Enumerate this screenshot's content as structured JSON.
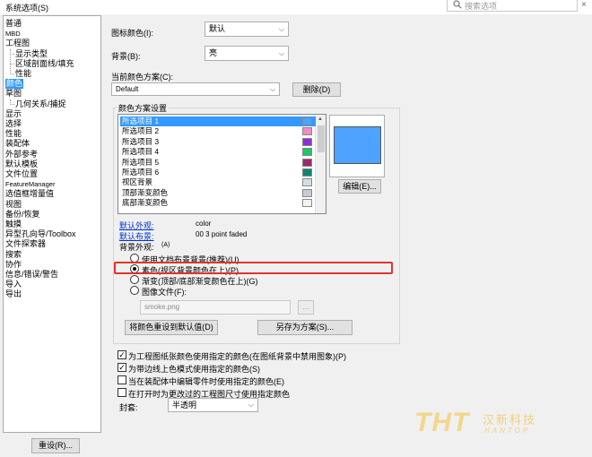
{
  "window": {
    "title": "系统选项(S)",
    "search_placeholder": "搜索选项",
    "close": "×"
  },
  "tree": {
    "items": [
      {
        "label": "普通",
        "level": 0,
        "selected": false
      },
      {
        "label": "MBD",
        "level": 0,
        "selected": false,
        "small": true
      },
      {
        "label": "工程图",
        "level": 0,
        "selected": false
      },
      {
        "label": "显示类型",
        "level": 1,
        "selected": false
      },
      {
        "label": "区域剖面线/填充",
        "level": 1,
        "selected": false
      },
      {
        "label": "性能",
        "level": 1,
        "selected": false
      },
      {
        "label": "颜色",
        "level": 0,
        "selected": true
      },
      {
        "label": "草图",
        "level": 0,
        "selected": false
      },
      {
        "label": "几何关系/捕捉",
        "level": 1,
        "selected": false
      },
      {
        "label": "显示",
        "level": 0,
        "selected": false
      },
      {
        "label": "选择",
        "level": 0,
        "selected": false
      },
      {
        "label": "性能",
        "level": 0,
        "selected": false
      },
      {
        "label": "装配体",
        "level": 0,
        "selected": false
      },
      {
        "label": "外部参考",
        "level": 0,
        "selected": false
      },
      {
        "label": "默认模板",
        "level": 0,
        "selected": false
      },
      {
        "label": "文件位置",
        "level": 0,
        "selected": false
      },
      {
        "label": "FeatureManager",
        "level": 0,
        "selected": false,
        "small": true
      },
      {
        "label": "选值框增量值",
        "level": 0,
        "selected": false
      },
      {
        "label": "视图",
        "level": 0,
        "selected": false
      },
      {
        "label": "备份/恢复",
        "level": 0,
        "selected": false
      },
      {
        "label": "触摸",
        "level": 0,
        "selected": false
      },
      {
        "label": "异型孔向导/Toolbox",
        "level": 0,
        "selected": false
      },
      {
        "label": "文件探索器",
        "level": 0,
        "selected": false
      },
      {
        "label": "搜索",
        "level": 0,
        "selected": false
      },
      {
        "label": "协作",
        "level": 0,
        "selected": false
      },
      {
        "label": "信息/错误/警告",
        "level": 0,
        "selected": false
      },
      {
        "label": "导入",
        "level": 0,
        "selected": false
      },
      {
        "label": "导出",
        "level": 0,
        "selected": false
      }
    ],
    "reset_button": "重设(R)..."
  },
  "colors": {
    "icon_color_label": "图标颜色(I):",
    "icon_color_value": "默认",
    "background_label": "背景(B):",
    "background_value": "亮",
    "scheme_label": "当前颜色方案(C):",
    "scheme_value": "Default",
    "delete_button": "删除(D)",
    "settings_group_title": "颜色方案设置",
    "list_items": [
      {
        "label": "所选项目 1",
        "color": "#4da3ff",
        "selected": true
      },
      {
        "label": "所选项目 2",
        "color": "#f08cc8",
        "selected": false
      },
      {
        "label": "所选项目 3",
        "color": "#8c2ee0",
        "selected": false
      },
      {
        "label": "所选项目 4",
        "color": "#1fc76a",
        "selected": false
      },
      {
        "label": "所选项目 5",
        "color": "#9a2a6a",
        "selected": false
      },
      {
        "label": "所选项目 6",
        "color": "#11856e",
        "selected": false
      },
      {
        "label": "视区背景",
        "color": "#d8dde2",
        "selected": false
      },
      {
        "label": "顶部渐变颜色",
        "color": "#c6ccd3",
        "selected": false
      },
      {
        "label": "底部渐变颜色",
        "color": "#f2f2f2",
        "selected": false
      }
    ],
    "edit_button": "编辑(E)...",
    "default_appearance_label": "默认外观:",
    "default_appearance_value": "color",
    "default_scene_label": "默认布景:",
    "default_scene_value": "00 3 point faded",
    "background_appearance_label": "背景外观:",
    "background_appearance_hint": "(A)",
    "radio_options": [
      {
        "label": "使用文档布景背景(推荐)(U)",
        "checked": false
      },
      {
        "label": "素色(视区背景颜色在上)(P)",
        "checked": true
      },
      {
        "label": "渐变(顶部/底部渐变颜色在上)(G)",
        "checked": false
      },
      {
        "label": "图像文件(F):",
        "checked": false
      }
    ],
    "image_file_value": "smoke.png",
    "browse_button": "...",
    "reset_colors_button": "将颜色重设到默认值(D)",
    "save_scheme_button": "另存为方案(S)...",
    "checkboxes": [
      {
        "label": "为工程图纸张颜色使用指定的颜色(在图纸背景中禁用图象)(P)",
        "checked": true
      },
      {
        "label": "为带边线上色模式使用指定的颜色(S)",
        "checked": true
      },
      {
        "label": "当在装配体中编辑零件时使用指定的颜色(E)",
        "checked": false
      },
      {
        "label": "在打开时为更改过的工程图尺寸使用指定颜色",
        "checked": false
      }
    ],
    "envelope_label": "封套:",
    "envelope_value": "半透明"
  },
  "watermark": {
    "logo": "THT",
    "cn": "汉新科技",
    "en": "HANTOP"
  }
}
